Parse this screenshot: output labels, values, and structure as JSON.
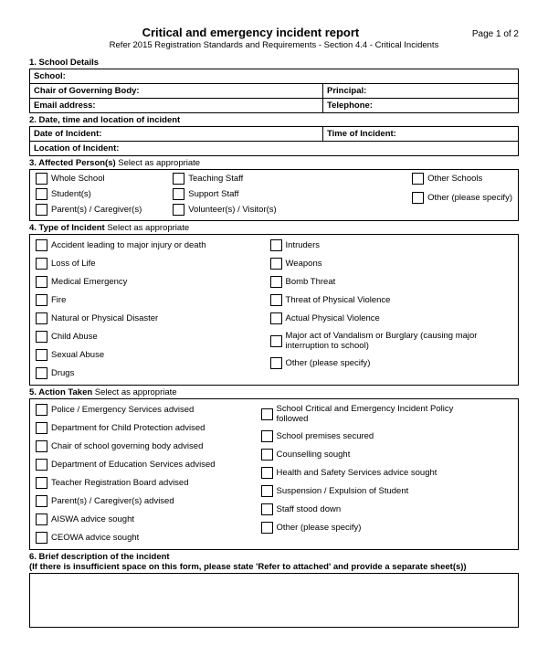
{
  "header": {
    "title": "Critical and emergency incident report",
    "subtitle": "Refer 2015 Registration Standards and Requirements - Section 4.4 - Critical Incidents",
    "page": "Page 1 of 2"
  },
  "s1": {
    "head": "1.  School Details",
    "school": "School:",
    "chair": "Chair of Governing Body:",
    "principal": "Principal:",
    "email": "Email address:",
    "telephone": "Telephone:"
  },
  "s2": {
    "head": "2.  Date, time and location of incident",
    "date": "Date of Incident:",
    "time": "Time of Incident:",
    "location": "Location of Incident:"
  },
  "s3": {
    "head": "3.  Affected Person(s)",
    "instr": " Select as appropriate",
    "col1": [
      "Whole School",
      "Student(s)",
      "Parent(s) / Caregiver(s)"
    ],
    "col2": [
      "Teaching Staff",
      "Support Staff",
      "Volunteer(s) / Visitor(s)"
    ],
    "col3": [
      "Other Schools",
      "Other (please specify)"
    ]
  },
  "s4": {
    "head": "4.  Type of Incident",
    "instr": " Select as appropriate",
    "col1": [
      "Accident leading to major injury or death",
      "Loss of Life",
      "Medical Emergency",
      "Fire",
      "Natural or Physical Disaster",
      "Child Abuse",
      "Sexual Abuse",
      "Drugs"
    ],
    "col2": [
      "Intruders",
      "Weapons",
      "Bomb Threat",
      "Threat of Physical Violence",
      "Actual Physical Violence",
      "Major act of Vandalism or Burglary (causing major interruption to school)",
      "Other (please specify)"
    ]
  },
  "s5": {
    "head": "5.  Action Taken",
    "instr": " Select as appropriate",
    "col1": [
      "Police / Emergency Services advised",
      "Department for Child Protection advised",
      "Chair of school governing body advised",
      "Department of Education Services advised",
      "Teacher Registration Board advised",
      "Parent(s) / Caregiver(s) advised",
      "AISWA advice sought",
      "CEOWA advice sought"
    ],
    "col2": [
      "School Critical and Emergency Incident Policy followed",
      "School premises secured",
      "Counselling sought",
      "Health and Safety Services advice sought",
      "Suspension / Expulsion of Student",
      "Staff stood down",
      "Other (please specify)"
    ]
  },
  "s6": {
    "head": "6.  Brief description of the incident",
    "note": "(If there is insufficient space on this form, please state 'Refer to attached' and provide a separate sheet(s))"
  }
}
